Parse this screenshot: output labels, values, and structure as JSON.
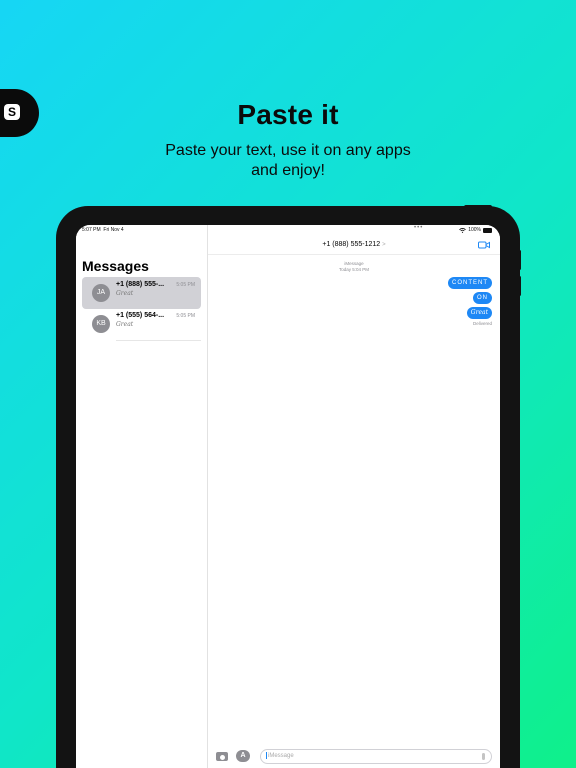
{
  "badge": {
    "letter": "S"
  },
  "headline": "Paste it",
  "subhead": "Paste your text, use it on any apps and enjoy!",
  "status_bar": {
    "time": "5:07 PM",
    "date": "Fri Nov 4",
    "dots": "•••",
    "battery": "100%"
  },
  "sidebar": {
    "title": "Messages",
    "conversations": [
      {
        "initials": "JA",
        "name": "+1 (888) 555-...",
        "time": "5:05 PM",
        "preview": "Great",
        "selected": true
      },
      {
        "initials": "KB",
        "name": "+1 (555) 564-...",
        "time": "5:05 PM",
        "preview": "Great",
        "selected": false
      }
    ]
  },
  "chat": {
    "title": "+1 (888) 555-1212",
    "chevron": ">",
    "service": "iMessage",
    "timestamp": "Today 5:04 PM",
    "messages": [
      "CONTENT",
      "ON",
      "Great"
    ],
    "delivered": "Delivered",
    "input_placeholder": "iMessage"
  },
  "colors": {
    "bubble": "#1e88f5",
    "background_start": "#16d6f5",
    "background_end": "#0ff08a"
  },
  "icons": [
    "app-badge-icon",
    "wifi-icon",
    "battery-icon",
    "video-camera-icon",
    "camera-icon",
    "app-store-icon",
    "microphone-icon"
  ]
}
